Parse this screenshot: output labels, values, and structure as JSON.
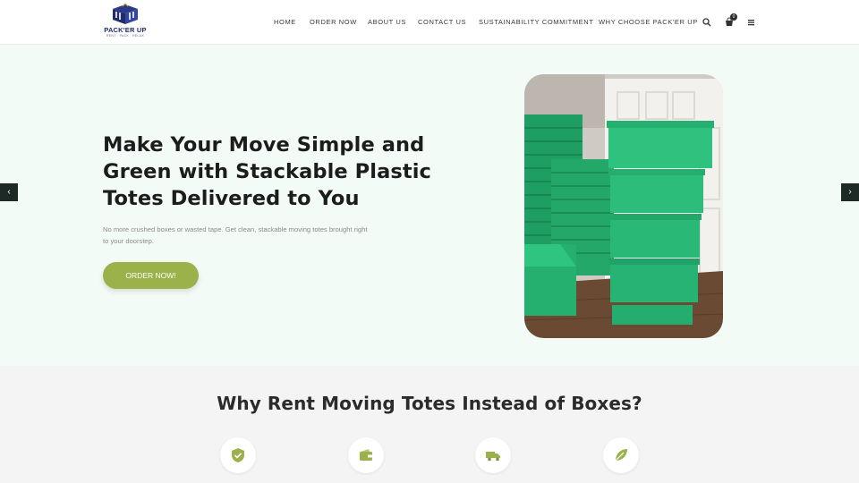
{
  "brand": {
    "name": "PACK'ER UP",
    "tagline": "RENT · PACK · RELAX",
    "accent": "#9bb14a",
    "hero_bg": "#f3fbf6"
  },
  "nav": {
    "items": [
      {
        "label": "HOME"
      },
      {
        "label": "ORDER NOW"
      },
      {
        "label": "ABOUT US"
      },
      {
        "label": "CONTACT US"
      },
      {
        "label": "SUSTAINABILITY COMMITMENT"
      },
      {
        "label": "WHY CHOOSE PACK'ER UP"
      }
    ],
    "icons": [
      "search-icon",
      "cart-icon",
      "menu-icon"
    ],
    "cart_count": "0"
  },
  "hero": {
    "title": "Make Your Move Simple and Green with Stackable Plastic Totes Delivered to You",
    "subtitle": "No more crushed boxes or wasted tape. Get clean, stackable moving totes brought right to your doorstep.",
    "cta_label": "ORDER NOW!",
    "prev_arrow": "‹",
    "next_arrow": "›"
  },
  "section2": {
    "title": "Why Rent Moving Totes Instead of Boxes?",
    "features": [
      {
        "icon": "shield-check-icon"
      },
      {
        "icon": "wallet-icon"
      },
      {
        "icon": "truck-icon"
      },
      {
        "icon": "leaf-icon"
      }
    ]
  }
}
